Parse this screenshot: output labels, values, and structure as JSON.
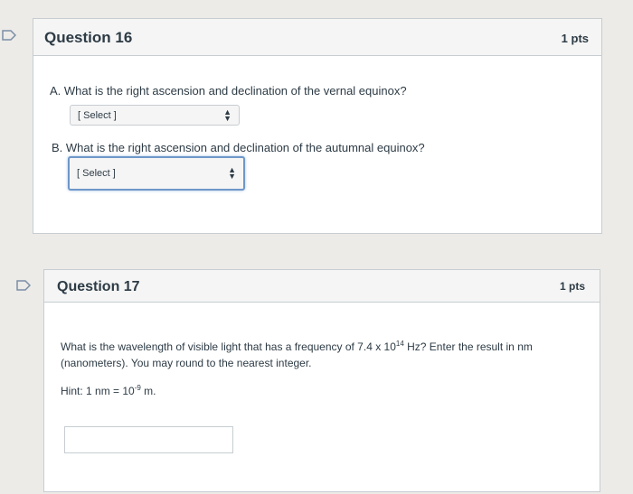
{
  "q16": {
    "title": "Question 16",
    "points": "1 pts",
    "part_a": "A. What is the right ascension and declination of the vernal equinox?",
    "part_a_select": "[ Select ]",
    "part_b": "B. What is the right ascension and declination of the autumnal equinox?",
    "part_b_select": "[ Select ]"
  },
  "q17": {
    "title": "Question 17",
    "points": "1 pts",
    "text_pre": "What is the wavelength of visible light that has a frequency of 7.4 x 10",
    "exp": "14",
    "text_post": " Hz? Enter the result in nm",
    "text_line2": "(nanometers). You may round to the nearest integer.",
    "hint_pre": "Hint: 1 nm = 10",
    "hint_exp": "-9",
    "hint_post": " m.",
    "answer_value": ""
  },
  "colors": {
    "flag_outline": "#7b8ea6",
    "focus_border": "#6d97c9"
  },
  "icons": [
    "bookmark-flag-icon",
    "select-arrows-icon"
  ]
}
